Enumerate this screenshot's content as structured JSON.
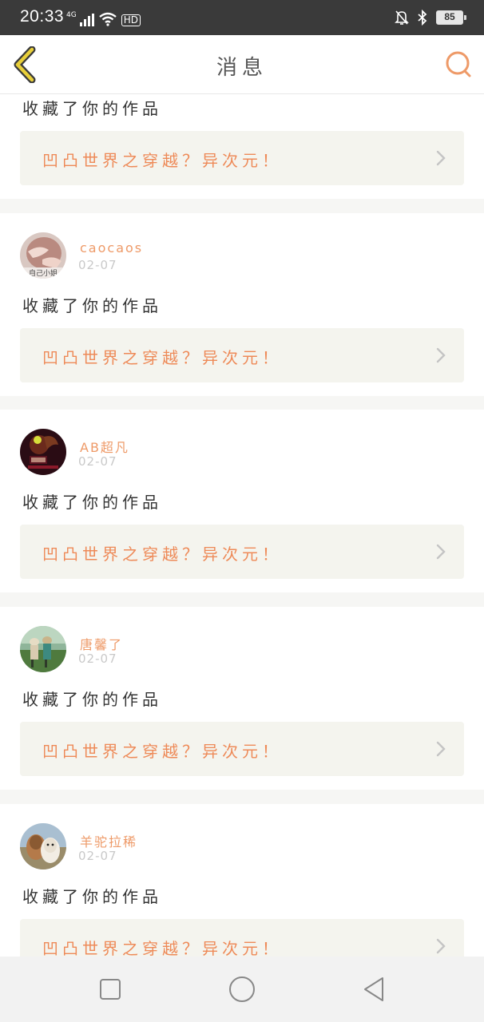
{
  "status_bar": {
    "time": "20:33",
    "network": "4G",
    "hd": "HD",
    "battery": "85",
    "icons": [
      "signal-icon",
      "wifi-icon",
      "hd-icon",
      "mute-icon",
      "bluetooth-icon",
      "battery-icon"
    ]
  },
  "header": {
    "title": "消息",
    "back_icon": "chevron-left-icon",
    "search_icon": "search-icon",
    "accent_color": "#ee9a68"
  },
  "messages": [
    {
      "action": "收藏了你的作品",
      "work_title": "凹凸世界之穿越？异次元！"
    },
    {
      "username": "caocaos",
      "date": "02-07",
      "action": "收藏了你的作品",
      "work_title": "凹凸世界之穿越？异次元！",
      "avatar_text": "自己小姐"
    },
    {
      "username": "AB超凡",
      "date": "02-07",
      "action": "收藏了你的作品",
      "work_title": "凹凸世界之穿越？异次元！"
    },
    {
      "username": "唐馨了",
      "date": "02-07",
      "action": "收藏了你的作品",
      "work_title": "凹凸世界之穿越？异次元！"
    },
    {
      "username": "羊驼拉稀",
      "date": "02-07",
      "action": "收藏了你的作品",
      "work_title": "凹凸世界之穿越？异次元！"
    }
  ],
  "nav_bar": {
    "icons": [
      "recents-square-icon",
      "home-circle-icon",
      "back-triangle-icon"
    ]
  }
}
